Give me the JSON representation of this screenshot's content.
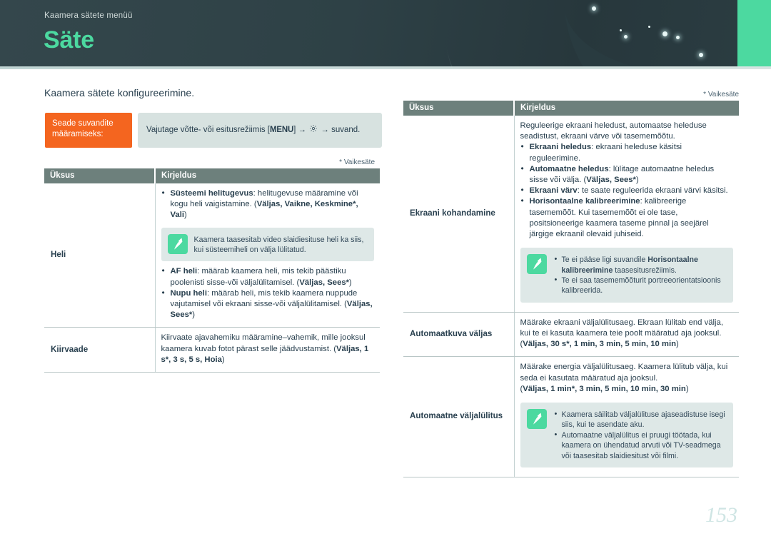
{
  "header": {
    "kicker": "Kaamera sätete menüü",
    "title": "Säte",
    "accent_color": "#4cd9a0",
    "background_color": "#2f4247"
  },
  "intro": "Kaamera sätete konfigureerimine.",
  "callout": {
    "label": "Seade suvandite määramiseks:",
    "text_before": "Vajutage võtte- või esitusrežiimis [",
    "menu_key": "MENU",
    "text_mid": "]",
    "arrow": "→",
    "gear_icon": "gear-icon",
    "text_after": "suvand.",
    "label_color": "#f4651f",
    "box_color": "#d7e2e0"
  },
  "default_note": "* Vaikesäte",
  "table": {
    "col_item": "Üksus",
    "col_desc": "Kirjeldus",
    "header_color": "#6d807c"
  },
  "left_rows": [
    {
      "item": "Heli",
      "bullets": [
        {
          "bold": "Süsteemi helitugevus",
          "rest": ": helitugevuse määramine või kogu heli vaigistamine. (",
          "options": "Väljas, Vaikne, Keskmine*, Vali",
          "tail": ")"
        }
      ],
      "note": {
        "icon": "pen-note-icon",
        "lines": [
          "Kaamera taasesitab video slaidiesituse heli ka siis, kui süsteemiheli on välja lülitatud."
        ]
      },
      "bullets_after": [
        {
          "bold": "AF heli",
          "rest": ": määrab kaamera heli, mis tekib päästiku poolenisti sisse-või väljalülitamisel. (",
          "options": "Väljas, Sees*",
          "tail": ")"
        },
        {
          "bold": "Nupu heli",
          "rest": ": määrab heli, mis tekib kaamera nuppude vajutamisel või ekraani sisse-või väljalülitamisel. (",
          "options": "Väljas, Sees*",
          "tail": ")"
        }
      ]
    },
    {
      "item": "Kiirvaade",
      "plain": "Kiirvaate ajavahemiku määramine–vahemik, mille jooksul kaamera kuvab fotot pärast selle jäädvustamist. (",
      "options": "Väljas, 1 s*, 3 s, 5 s, Hoia",
      "tail": ")"
    }
  ],
  "right_rows": [
    {
      "item": "Ekraani kohandamine",
      "lead": "Reguleerige ekraani heledust, automaatse heleduse seadistust, ekraani värve või tasememõõtu.",
      "bullets": [
        {
          "bold": "Ekraani heledus",
          "rest": ": ekraani heleduse käsitsi reguleerimine.",
          "options": "",
          "tail": ""
        },
        {
          "bold": "Automaatne heledus",
          "rest": ": lülitage automaatne heledus sisse või välja. (",
          "options": "Väljas, Sees*",
          "tail": ")"
        },
        {
          "bold": "Ekraani värv",
          "rest": ": te saate reguleerida ekraani värvi käsitsi.",
          "options": "",
          "tail": ""
        },
        {
          "bold": "Horisontaalne kalibreerimine",
          "rest": ": kalibreerige tasememõõt. Kui tasememõõt ei ole tase, positsioneerige kaamera taseme pinnal ja seejärel järgige ekraanil olevaid juhiseid.",
          "options": "",
          "tail": ""
        }
      ],
      "note": {
        "icon": "pen-note-icon",
        "bullets": [
          {
            "pre": "Te ei pääse ligi suvandile ",
            "bold": "Horisontaalne kalibreerimine",
            "post": " taasesitusrežiimis."
          },
          {
            "pre": "Te ei saa tasememõõturit portreeorientatsioonis kalibreerida.",
            "bold": "",
            "post": ""
          }
        ]
      }
    },
    {
      "item": "Automaatkuva väljas",
      "plain": "Määrake ekraani väljalülitusaeg. Ekraan lülitab end välja, kui te ei kasuta kaamera teie poolt määratud aja jooksul. (",
      "options": "Väljas, 30 s*, 1 min, 3 min, 5 min, 10 min",
      "tail": ")"
    },
    {
      "item": "Automaatne väljalülitus",
      "plain": "Määrake energia väljalülitusaeg. Kaamera lülitub välja, kui seda ei kasutata määratud aja jooksul.",
      "options_line_pre": "(",
      "options": "Väljas, 1 min*, 3 min, 5 min, 10 min, 30 min",
      "tail": ")",
      "note": {
        "icon": "pen-note-icon",
        "bullets": [
          {
            "pre": "Kaamera säilitab väljalülituse ajaseadistuse isegi siis, kui te asendate aku.",
            "bold": "",
            "post": ""
          },
          {
            "pre": "Automaatne väljalülitus ei pruugi töötada, kui kaamera on ühendatud arvuti või TV-seadmega või taasesitab slaidiesitust või filmi.",
            "bold": "",
            "post": ""
          }
        ]
      }
    }
  ],
  "page_number": "153"
}
